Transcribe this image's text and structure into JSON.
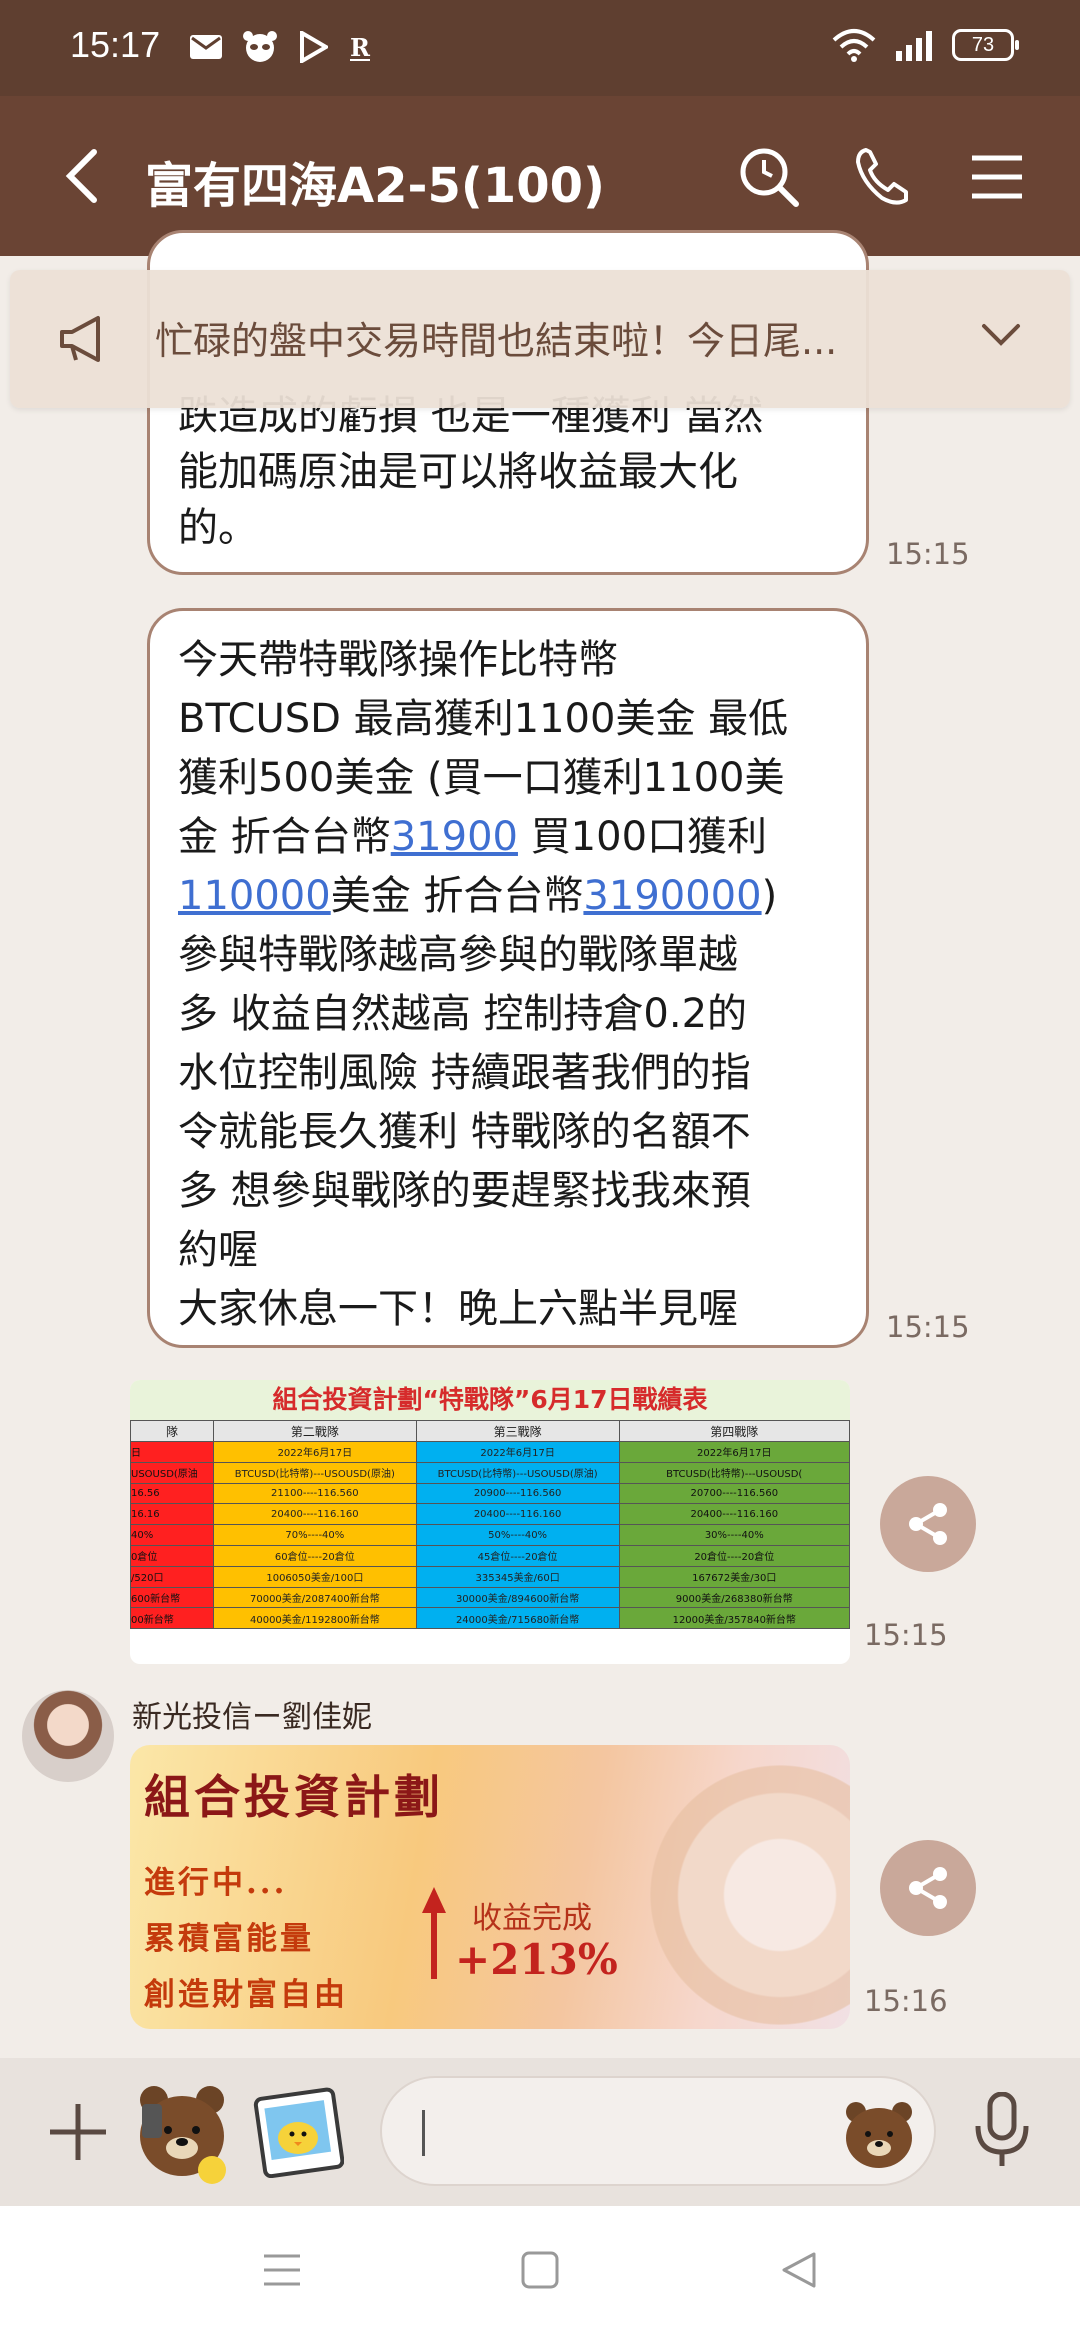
{
  "status_bar": {
    "time": "15:17",
    "battery": "73"
  },
  "header": {
    "title": "富有四海A2-5(100)"
  },
  "announcement": {
    "text": "忙碌的盤中交易時間也結束啦！今日尾..."
  },
  "messages": [
    {
      "lines": [
        "跌造成的虧損 也是一種獲利 當然",
        "能加碼原油是可以將收益最大化",
        "的。"
      ],
      "time": "15:15"
    },
    {
      "line1": "今天帶特戰隊操作比特幣",
      "line2": "BTCUSD 最高獲利1100美金 最低",
      "line3": "獲利500美金 (買一口獲利1100美",
      "line4_a": "金 折合台幣",
      "line4_link": "31900",
      "line4_b": " 買100口獲利",
      "line5_link1": "110000",
      "line5_a": "美金 折合台幣",
      "line5_link2": "3190000",
      "line5_b": ")",
      "rest": [
        "參與特戰隊越高參與的戰隊單越",
        "多 收益自然越高 控制持倉0.2的",
        "水位控制風險 持續跟著我們的指",
        "令就能長久獲利 特戰隊的名額不",
        "多 想參與戰隊的要趕緊找我來預",
        "約喔",
        "大家休息一下！晚上六點半見喔"
      ],
      "time": "15:15"
    }
  ],
  "table_image": {
    "title": "組合投資計劃“特戰隊”6月17日戰績表",
    "headers": [
      "隊",
      "第二戰隊",
      "第三戰隊",
      "第四戰隊"
    ],
    "rows": [
      [
        "日",
        "2022年6月17日",
        "2022年6月17日",
        "2022年6月17日"
      ],
      [
        "USOUSD(原油",
        "BTCUSD(比特幣)---USOUSD(原油)",
        "BTCUSD(比特幣)---USOUSD(原油)",
        "BTCUSD(比特幣)---USOUSD("
      ],
      [
        "16.56",
        "21100----116.560",
        "20900----116.560",
        "20700----116.560"
      ],
      [
        "16.16",
        "20400----116.160",
        "20400----116.160",
        "20400----116.160"
      ],
      [
        "40%",
        "70%----40%",
        "50%----40%",
        "30%----40%"
      ],
      [
        "0倉位",
        "60倉位----20倉位",
        "45倉位----20倉位",
        "20倉位----20倉位"
      ],
      [
        "/520口",
        "1006050美金/100口",
        "335345美金/60口",
        "167672美金/30口"
      ],
      [
        "600新台幣",
        "70000美金/2087400新台幣",
        "30000美金/894600新台幣",
        "9000美金/268380新台幣"
      ],
      [
        "00新台幣",
        "40000美金/1192800新台幣",
        "24000美金/715680新台幣",
        "12000美金/357840新台幣"
      ]
    ],
    "time": "15:15"
  },
  "sender": {
    "name": "新光投信ー劉佳妮"
  },
  "promo_image": {
    "title": "組合投資計劃",
    "lines": [
      "進行中...",
      "累積富能量",
      "創造財富自由"
    ],
    "done_label": "收益完成",
    "percent": "+213%",
    "time": "15:16"
  },
  "colors": {
    "header_bg": "#6a4434",
    "status_bg": "#5f3f30",
    "chat_bg": "#f2ede8",
    "bubble_border": "#a88372",
    "link": "#3f6fd1"
  }
}
